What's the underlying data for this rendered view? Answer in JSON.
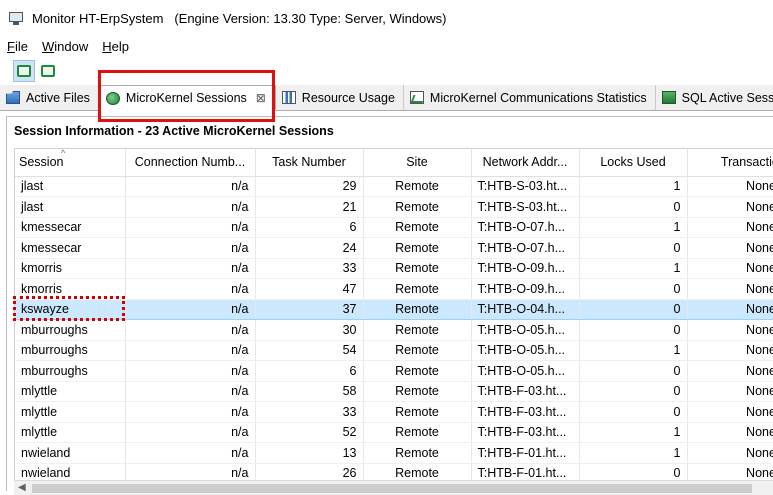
{
  "window": {
    "title": "Monitor HT-ErpSystem",
    "subtitle": "(Engine Version: 13.30  Type: Server, Windows)"
  },
  "menu": [
    {
      "label": "File",
      "u": "F",
      "rest": "ile"
    },
    {
      "label": "Window",
      "u": "W",
      "rest": "indow"
    },
    {
      "label": "Help",
      "u": "H",
      "rest": "elp"
    }
  ],
  "toolbar": {
    "buttons": [
      {
        "icon": "session-monitor-icon",
        "active": true
      },
      {
        "icon": "refresh-monitor-icon",
        "active": false
      }
    ]
  },
  "tabs": [
    {
      "label": "Active Files",
      "icon": "files-icon",
      "active": false
    },
    {
      "label": "MicroKernel Sessions",
      "icon": "microkernel-icon",
      "active": true,
      "close": "⊠"
    },
    {
      "label": "Resource Usage",
      "icon": "resource-chart-icon",
      "active": false
    },
    {
      "label": "MicroKernel Communications Statistics",
      "icon": "comm-stats-icon",
      "active": false
    },
    {
      "label": "SQL Active Session",
      "icon": "sql-icon",
      "active": false
    }
  ],
  "section": {
    "title": "Session Information - 23 Active MicroKernel Sessions"
  },
  "table": {
    "columns": [
      "Session",
      "Connection Numb...",
      "Task Number",
      "Site",
      "Network Addr...",
      "Locks Used",
      "Transaction St"
    ],
    "rows": [
      [
        "jlast",
        "n/a",
        "29",
        "Remote",
        "T:HTB-S-03.ht...",
        "1",
        "None"
      ],
      [
        "jlast",
        "n/a",
        "21",
        "Remote",
        "T:HTB-S-03.ht...",
        "0",
        "None"
      ],
      [
        "kmessecar",
        "n/a",
        "6",
        "Remote",
        "T:HTB-O-07.h...",
        "1",
        "None"
      ],
      [
        "kmessecar",
        "n/a",
        "24",
        "Remote",
        "T:HTB-O-07.h...",
        "0",
        "None"
      ],
      [
        "kmorris",
        "n/a",
        "33",
        "Remote",
        "T:HTB-O-09.h...",
        "1",
        "None"
      ],
      [
        "kmorris",
        "n/a",
        "47",
        "Remote",
        "T:HTB-O-09.h...",
        "0",
        "None"
      ],
      [
        "kswayze",
        "n/a",
        "37",
        "Remote",
        "T:HTB-O-04.h...",
        "0",
        "None"
      ],
      [
        "mburroughs",
        "n/a",
        "30",
        "Remote",
        "T:HTB-O-05.h...",
        "0",
        "None"
      ],
      [
        "mburroughs",
        "n/a",
        "54",
        "Remote",
        "T:HTB-O-05.h...",
        "1",
        "None"
      ],
      [
        "mburroughs",
        "n/a",
        "6",
        "Remote",
        "T:HTB-O-05.h...",
        "0",
        "None"
      ],
      [
        "mlyttle",
        "n/a",
        "58",
        "Remote",
        "T:HTB-F-03.ht...",
        "0",
        "None"
      ],
      [
        "mlyttle",
        "n/a",
        "33",
        "Remote",
        "T:HTB-F-03.ht...",
        "0",
        "None"
      ],
      [
        "mlyttle",
        "n/a",
        "52",
        "Remote",
        "T:HTB-F-03.ht...",
        "1",
        "None"
      ],
      [
        "nwieland",
        "n/a",
        "13",
        "Remote",
        "T:HTB-F-01.ht...",
        "1",
        "None"
      ],
      [
        "nwieland",
        "n/a",
        "26",
        "Remote",
        "T:HTB-F-01.ht...",
        "0",
        "None"
      ]
    ],
    "selected_row": 6
  },
  "colors": {
    "highlight_border": "#e01010",
    "selection": "#cce8ff"
  }
}
